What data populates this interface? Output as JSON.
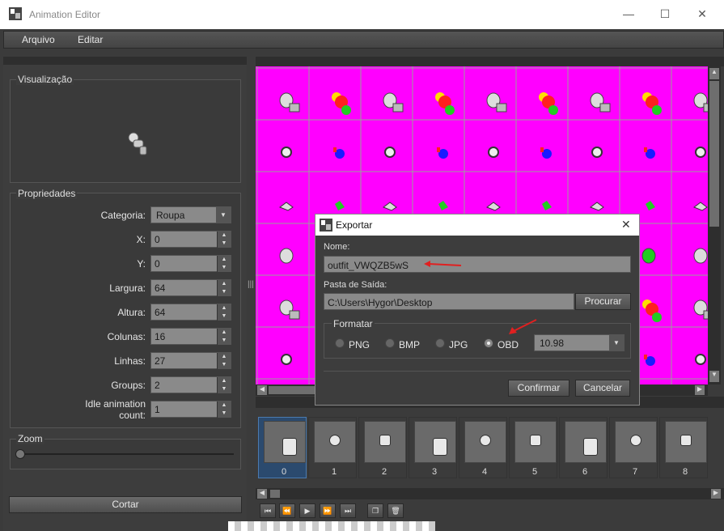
{
  "window": {
    "title": "Animation Editor",
    "minimize": "—",
    "maximize": "☐",
    "close": "✕"
  },
  "menu": {
    "items": [
      "Arquivo",
      "Editar"
    ]
  },
  "left": {
    "preview_label": "Visualização",
    "props_label": "Propriedades",
    "props": [
      {
        "label": "Categoria:",
        "value": "Roupa",
        "kind": "combo"
      },
      {
        "label": "X:",
        "value": "0",
        "kind": "spin"
      },
      {
        "label": "Y:",
        "value": "0",
        "kind": "spin"
      },
      {
        "label": "Largura:",
        "value": "64",
        "kind": "spin"
      },
      {
        "label": "Altura:",
        "value": "64",
        "kind": "spin"
      },
      {
        "label": "Colunas:",
        "value": "16",
        "kind": "spin"
      },
      {
        "label": "Linhas:",
        "value": "27",
        "kind": "spin"
      },
      {
        "label": "Groups:",
        "value": "2",
        "kind": "spin"
      },
      {
        "label": "Idle animation count:",
        "value": "1",
        "kind": "spin"
      }
    ],
    "zoom_label": "Zoom",
    "cut_button": "Cortar"
  },
  "frames": {
    "numbers": [
      "0",
      "1",
      "2",
      "3",
      "4",
      "5",
      "6",
      "7",
      "8"
    ],
    "selected": 0
  },
  "dialog": {
    "title": "Exportar",
    "close": "✕",
    "name_label": "Nome:",
    "name_value": "outfit_VWQZB5wS",
    "folder_label": "Pasta de Saída:",
    "folder_value": "C:\\Users\\Hygor\\Desktop",
    "browse_button": "Procurar",
    "format_label": "Formatar",
    "formats": [
      "PNG",
      "BMP",
      "JPG",
      "OBD"
    ],
    "selected_format": "OBD",
    "version_value": "10.98",
    "confirm_button": "Confirmar",
    "cancel_button": "Cancelar"
  },
  "colors": {
    "sprite_bg": "#ff00ff",
    "grid": "#9aa09a",
    "annotation": "#e02020"
  }
}
